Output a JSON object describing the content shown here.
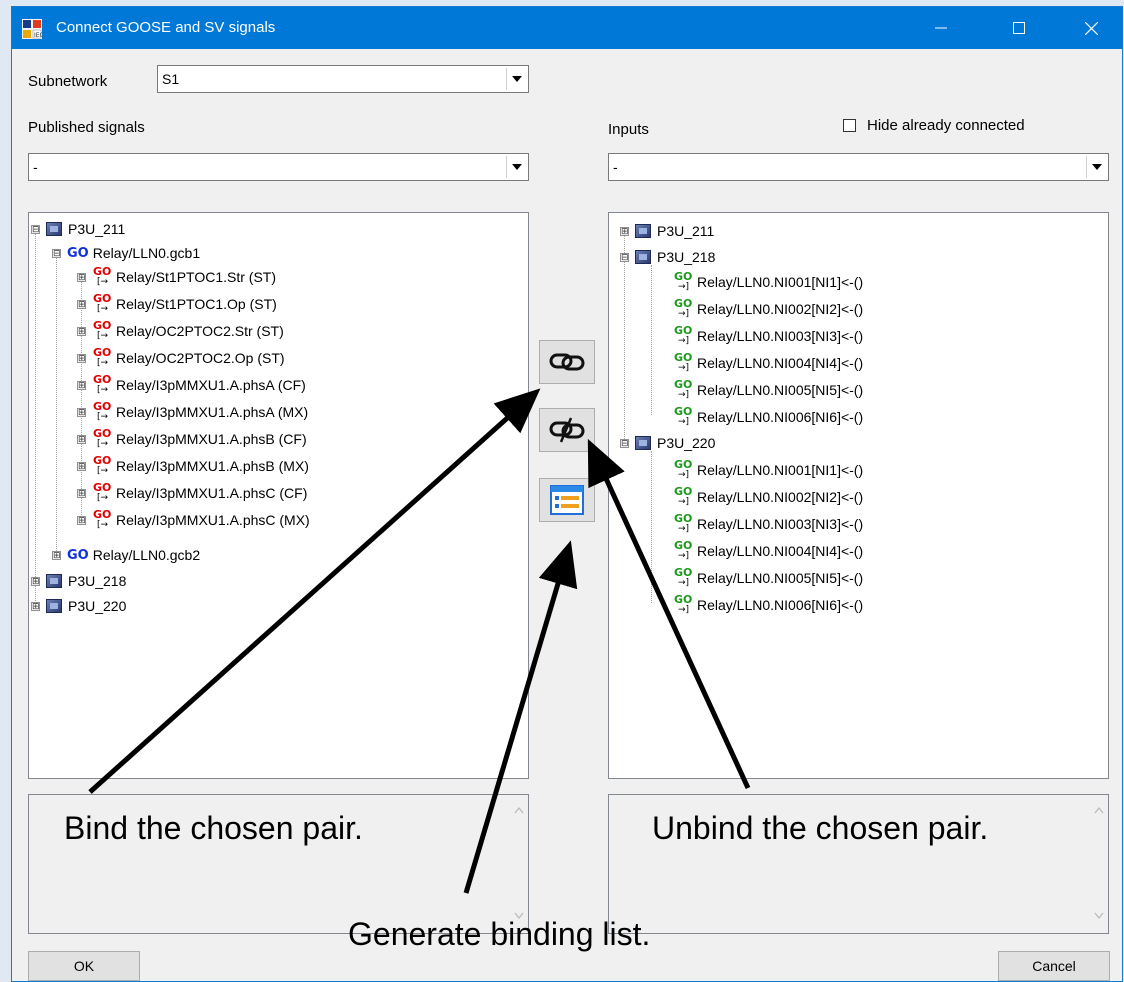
{
  "window": {
    "title": "Connect GOOSE and SV signals",
    "controls": {
      "minimize": "—",
      "maximize": "☐",
      "close": "✕"
    }
  },
  "subnetwork": {
    "label": "Subnetwork",
    "value": "S1"
  },
  "published": {
    "label": "Published signals",
    "filter_value": "-",
    "tree": [
      {
        "label": "P3U_211",
        "kind": "device",
        "expander": "⊟"
      },
      {
        "label": "Relay/LLN0.gcb1",
        "kind": "gcb",
        "expander": "⊟"
      },
      {
        "label": "Relay/St1PTOC1.Str (ST)",
        "kind": "signal",
        "expander": "⊞"
      },
      {
        "label": "Relay/St1PTOC1.Op (ST)",
        "kind": "signal",
        "expander": "⊞"
      },
      {
        "label": "Relay/OC2PTOC2.Str (ST)",
        "kind": "signal",
        "expander": "⊞"
      },
      {
        "label": "Relay/OC2PTOC2.Op (ST)",
        "kind": "signal",
        "expander": "⊞"
      },
      {
        "label": "Relay/I3pMMXU1.A.phsA (CF)",
        "kind": "signal",
        "expander": "⊞"
      },
      {
        "label": "Relay/I3pMMXU1.A.phsA (MX)",
        "kind": "signal",
        "expander": "⊞"
      },
      {
        "label": "Relay/I3pMMXU1.A.phsB (CF)",
        "kind": "signal",
        "expander": "⊞"
      },
      {
        "label": "Relay/I3pMMXU1.A.phsB (MX)",
        "kind": "signal",
        "expander": "⊞"
      },
      {
        "label": "Relay/I3pMMXU1.A.phsC (CF)",
        "kind": "signal",
        "expander": "⊞"
      },
      {
        "label": "Relay/I3pMMXU1.A.phsC (MX)",
        "kind": "signal",
        "expander": "⊞"
      },
      {
        "label": "Relay/LLN0.gcb2",
        "kind": "gcb",
        "expander": "⊞"
      },
      {
        "label": "P3U_218",
        "kind": "device",
        "expander": "⊞"
      },
      {
        "label": "P3U_220",
        "kind": "device",
        "expander": "⊞"
      }
    ]
  },
  "inputs": {
    "label": "Inputs",
    "filter_value": "-",
    "hide_connected_label": "Hide already connected",
    "hide_connected_checked": false,
    "tree": [
      {
        "label": "P3U_211",
        "kind": "device",
        "expander": "⊞"
      },
      {
        "label": "P3U_218",
        "kind": "device",
        "expander": "⊟"
      },
      {
        "label": "Relay/LLN0.NI001[NI1]<-()",
        "kind": "input"
      },
      {
        "label": "Relay/LLN0.NI002[NI2]<-()",
        "kind": "input"
      },
      {
        "label": "Relay/LLN0.NI003[NI3]<-()",
        "kind": "input"
      },
      {
        "label": "Relay/LLN0.NI004[NI4]<-()",
        "kind": "input"
      },
      {
        "label": "Relay/LLN0.NI005[NI5]<-()",
        "kind": "input"
      },
      {
        "label": "Relay/LLN0.NI006[NI6]<-()",
        "kind": "input"
      },
      {
        "label": "P3U_220",
        "kind": "device",
        "expander": "⊟"
      },
      {
        "label": "Relay/LLN0.NI001[NI1]<-()",
        "kind": "input"
      },
      {
        "label": "Relay/LLN0.NI002[NI2]<-()",
        "kind": "input"
      },
      {
        "label": "Relay/LLN0.NI003[NI3]<-()",
        "kind": "input"
      },
      {
        "label": "Relay/LLN0.NI004[NI4]<-()",
        "kind": "input"
      },
      {
        "label": "Relay/LLN0.NI005[NI5]<-()",
        "kind": "input"
      },
      {
        "label": "Relay/LLN0.NI006[NI6]<-()",
        "kind": "input"
      }
    ]
  },
  "go_glyph": "GO",
  "tools": {
    "bind_icon": "link-icon",
    "unbind_icon": "unlink-icon",
    "list_icon": "binding-list-icon"
  },
  "annotations": {
    "bind": "Bind the chosen pair.",
    "unbind": "Unbind the chosen pair.",
    "generate": "Generate binding list."
  },
  "buttons": {
    "ok": "OK",
    "cancel": "Cancel"
  },
  "colors": {
    "titlebar": "#0078d7",
    "go_red": "#e00000",
    "go_green": "#1a9a1a",
    "go_blue": "#1033d8"
  }
}
